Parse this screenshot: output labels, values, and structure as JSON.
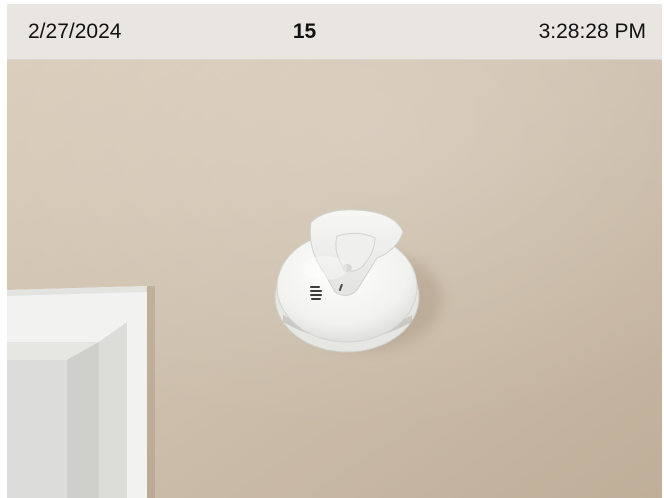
{
  "header": {
    "date": "2/27/2024",
    "count": "15",
    "time": "3:28:28 PM"
  },
  "photo": {
    "subject": "smoke-detector",
    "wall_color": "#cfc0ad",
    "detector_color": "#f4f4f2",
    "trim_color": "#f1f1ef"
  }
}
